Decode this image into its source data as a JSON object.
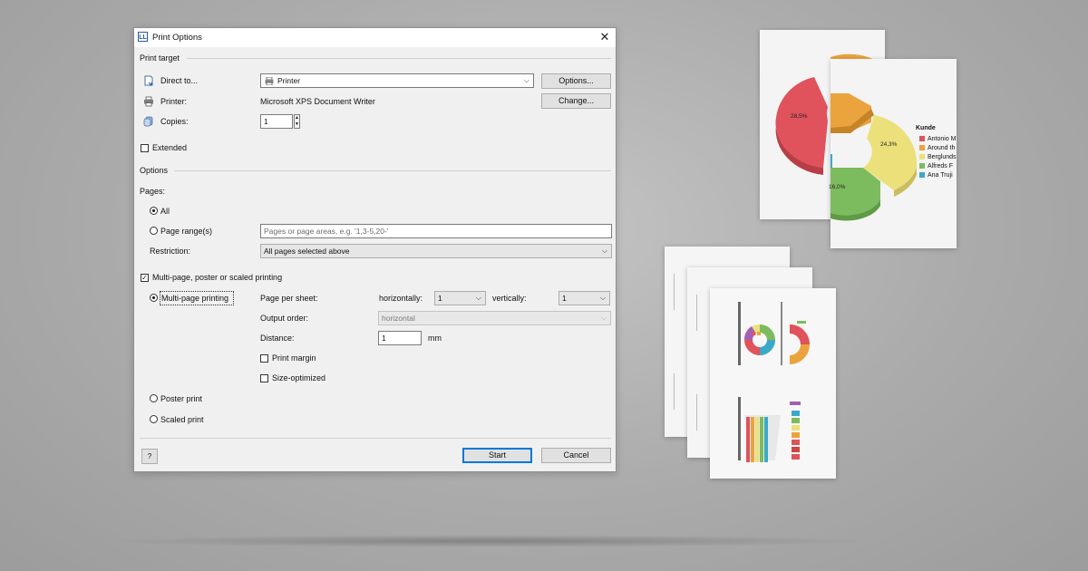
{
  "dialog": {
    "title": "Print Options",
    "close_icon": "close-icon",
    "print_target": {
      "section_label": "Print target",
      "direct_to_label": "Direct to...",
      "direct_to_value": "Printer",
      "options_button": "Options...",
      "printer_label": "Printer:",
      "printer_value": "Microsoft XPS Document Writer",
      "change_button": "Change...",
      "copies_label": "Copies:",
      "copies_value": "1",
      "extended_label": "Extended",
      "extended_checked": false
    },
    "options": {
      "section_label": "Options",
      "pages_label": "Pages:",
      "all_label": "All",
      "all_selected": true,
      "page_range_label": "Page range(s)",
      "page_range_placeholder": "Pages or page areas, e.g. '1,3-5,20-'",
      "restriction_label": "Restriction:",
      "restriction_value": "All pages selected above",
      "multipage_checkbox_label": "Multi-page, poster or scaled printing",
      "multipage_checked": true,
      "multipage_printing_label": "Multi-page printing",
      "multipage_printing_selected": true,
      "page_per_sheet_label": "Page per sheet:",
      "horizontally_label": "horizontally:",
      "horizontally_value": "1",
      "vertically_label": "vertically:",
      "vertically_value": "1",
      "output_order_label": "Output order:",
      "output_order_value": "horizontal",
      "distance_label": "Distance:",
      "distance_value": "1",
      "distance_unit": "mm",
      "print_margin_label": "Print margin",
      "print_margin_checked": false,
      "size_optimized_label": "Size-optimized",
      "size_optimized_checked": false,
      "poster_print_label": "Poster print",
      "scaled_print_label": "Scaled print"
    },
    "footer": {
      "help_icon": "help-icon",
      "start_button": "Start",
      "cancel_button": "Cancel"
    }
  },
  "preview": {
    "chart_data": {
      "type": "pie",
      "legend_title": "Kunde",
      "legend_entries": [
        "Antonio M",
        "Around th",
        "Berglunds",
        "Alfreds F",
        "Ana Truji"
      ],
      "slice_labels": [
        "28,5%",
        "24,3%",
        "16,0%"
      ],
      "colors": [
        "#e0525c",
        "#eba33d",
        "#ece07a",
        "#7dbb5f",
        "#3aa9c7"
      ]
    }
  }
}
